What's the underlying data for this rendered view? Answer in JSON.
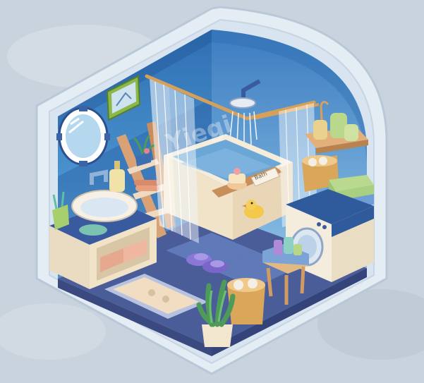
{
  "scene": {
    "watermark_text": "Yiegi",
    "book_text": "Bath",
    "colors": {
      "background": "#c9d3dd",
      "outer_shell": "#dfe8f1",
      "wall_blue": "#3f86c4",
      "wall_light": "#76b4de",
      "floor": "#4b5d98",
      "tub": "#f2e7d4",
      "water": "#6aa6d6",
      "copper": "#d7a05a",
      "cabinet": "#f1e3c8",
      "washer_cover": "#2f5a9c"
    },
    "icons": [
      "porthole-mirror",
      "framed-picture",
      "ladder-shelf",
      "sink",
      "toothbrush-cup",
      "bathtub",
      "shower-head",
      "shower-curtain",
      "rubber-duck",
      "bath-tray",
      "washing-machine",
      "wall-shelf",
      "laundry-basket",
      "slippers",
      "bath-mat",
      "potted-plant",
      "stool-basket",
      "towel-stack",
      "soap-bottle"
    ]
  }
}
